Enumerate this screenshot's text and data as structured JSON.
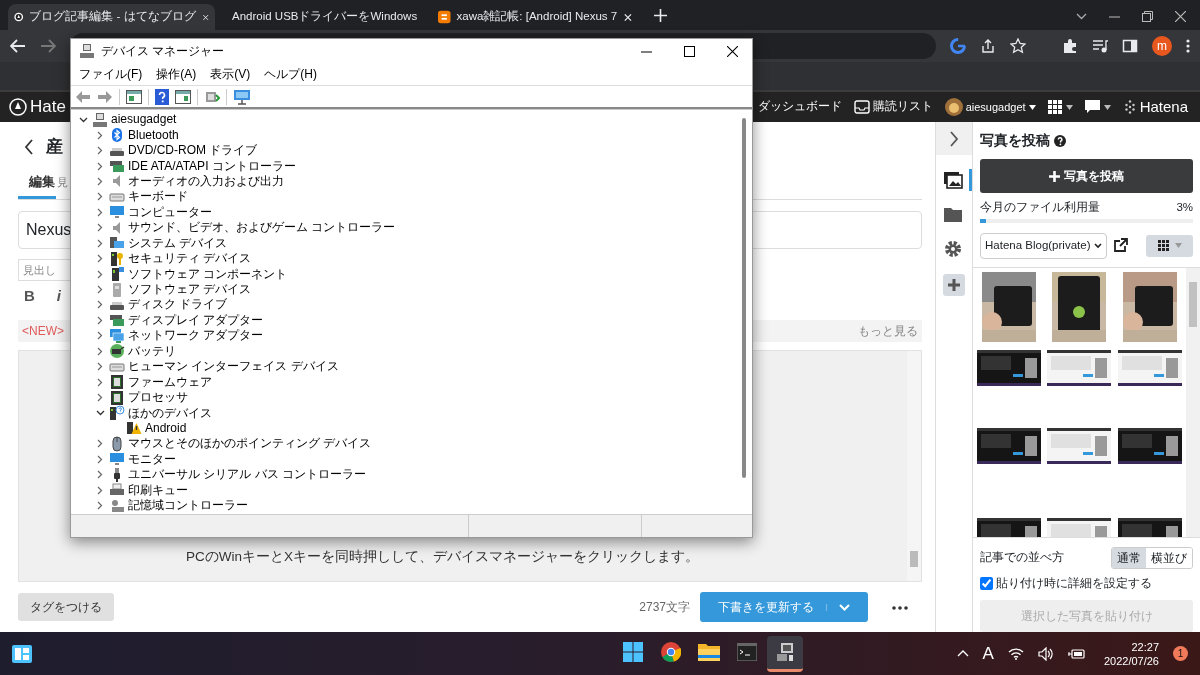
{
  "browser": {
    "tabs": [
      {
        "title": "ブログ記事編集 - はてなブログ",
        "selected": true
      },
      {
        "title": "Android USBドライバーをWindows",
        "selected": false
      },
      {
        "title": "xawa雑記帳: [Android] Nexus 7",
        "selected": false
      }
    ],
    "avatar": "m"
  },
  "hatena_header": {
    "logo": "Hate",
    "links": [
      "ダッシュボード",
      "購読リスト",
      "aiesugadget"
    ],
    "brand": "Hatena"
  },
  "editor": {
    "heading": "産",
    "tabs": [
      {
        "label": "編集",
        "selected": true
      },
      {
        "label": "見",
        "selected": false
      }
    ],
    "title_input": "Nexus",
    "heading_select": "見出し",
    "format_buttons": [
      "B",
      "i"
    ],
    "notice": "<NEW>",
    "more_link": "もっと見る",
    "body_text": "PCのWinキーとXキーを同時押しして、デバイスマネージャーをクリックします。",
    "tag_button": "タグをつける",
    "char_count": "2737文字",
    "save_button": "下書きを更新する"
  },
  "side_tabs": [
    {
      "selected": true
    },
    {
      "selected": false
    },
    {
      "selected": false
    }
  ],
  "photo_panel": {
    "title": "写真を投稿",
    "upload_button": "写真を投稿",
    "usage_label": "今月のファイル利用量",
    "usage_value": "3%",
    "usage": {
      "level": 0.03
    },
    "album_select": "Hatena Blog(private)",
    "layout_label": "記事での並べ方",
    "layout_options": [
      {
        "label": "通常",
        "selected": true
      },
      {
        "label": "横並び",
        "selected": false
      }
    ],
    "detail_checkbox": {
      "label": "貼り付け時に詳細を設定する",
      "checked": true
    },
    "paste_button": {
      "label": "選択した写真を貼り付け",
      "disabled": true
    }
  },
  "device_manager": {
    "title": "デバイス マネージャー",
    "menu": [
      "ファイル(F)",
      "操作(A)",
      "表示(V)",
      "ヘルプ(H)"
    ],
    "tree": [
      {
        "label": "aiesugadget",
        "expanded": true,
        "children": [
          {
            "label": "Bluetooth",
            "expanded": false
          },
          {
            "label": "DVD/CD-ROM ドライブ",
            "expanded": false
          },
          {
            "label": "IDE ATA/ATAPI コントローラー",
            "expanded": false
          },
          {
            "label": "オーディオの入力および出力",
            "expanded": false
          },
          {
            "label": "キーボード",
            "expanded": false
          },
          {
            "label": "コンピューター",
            "expanded": false
          },
          {
            "label": "サウンド、ビデオ、およびゲーム コントローラー",
            "expanded": false
          },
          {
            "label": "システム デバイス",
            "expanded": false
          },
          {
            "label": "セキュリティ デバイス",
            "expanded": false
          },
          {
            "label": "ソフトウェア コンポーネント",
            "expanded": false
          },
          {
            "label": "ソフトウェア デバイス",
            "expanded": false
          },
          {
            "label": "ディスク ドライブ",
            "expanded": false
          },
          {
            "label": "ディスプレイ アダプター",
            "expanded": false
          },
          {
            "label": "ネットワーク アダプター",
            "expanded": false
          },
          {
            "label": "バッテリ",
            "expanded": false
          },
          {
            "label": "ヒューマン インターフェイス デバイス",
            "expanded": false
          },
          {
            "label": "ファームウェア",
            "expanded": false
          },
          {
            "label": "プロセッサ",
            "expanded": false
          },
          {
            "label": "ほかのデバイス",
            "expanded": true,
            "children": [
              {
                "label": "Android"
              }
            ]
          },
          {
            "label": "マウスとそのほかのポインティング デバイス",
            "expanded": false
          },
          {
            "label": "モニター",
            "expanded": false
          },
          {
            "label": "ユニバーサル シリアル バス コントローラー",
            "expanded": false
          },
          {
            "label": "印刷キュー",
            "expanded": false
          },
          {
            "label": "記憶域コントローラー",
            "expanded": false
          }
        ]
      }
    ]
  },
  "taskbar": {
    "apps": [
      {
        "selected": false
      },
      {
        "selected": false
      },
      {
        "selected": false
      },
      {
        "selected": false
      },
      {
        "selected": true
      }
    ],
    "ime": "A",
    "time": "22:27",
    "date": "2022/07/26",
    "notifications": "1"
  }
}
